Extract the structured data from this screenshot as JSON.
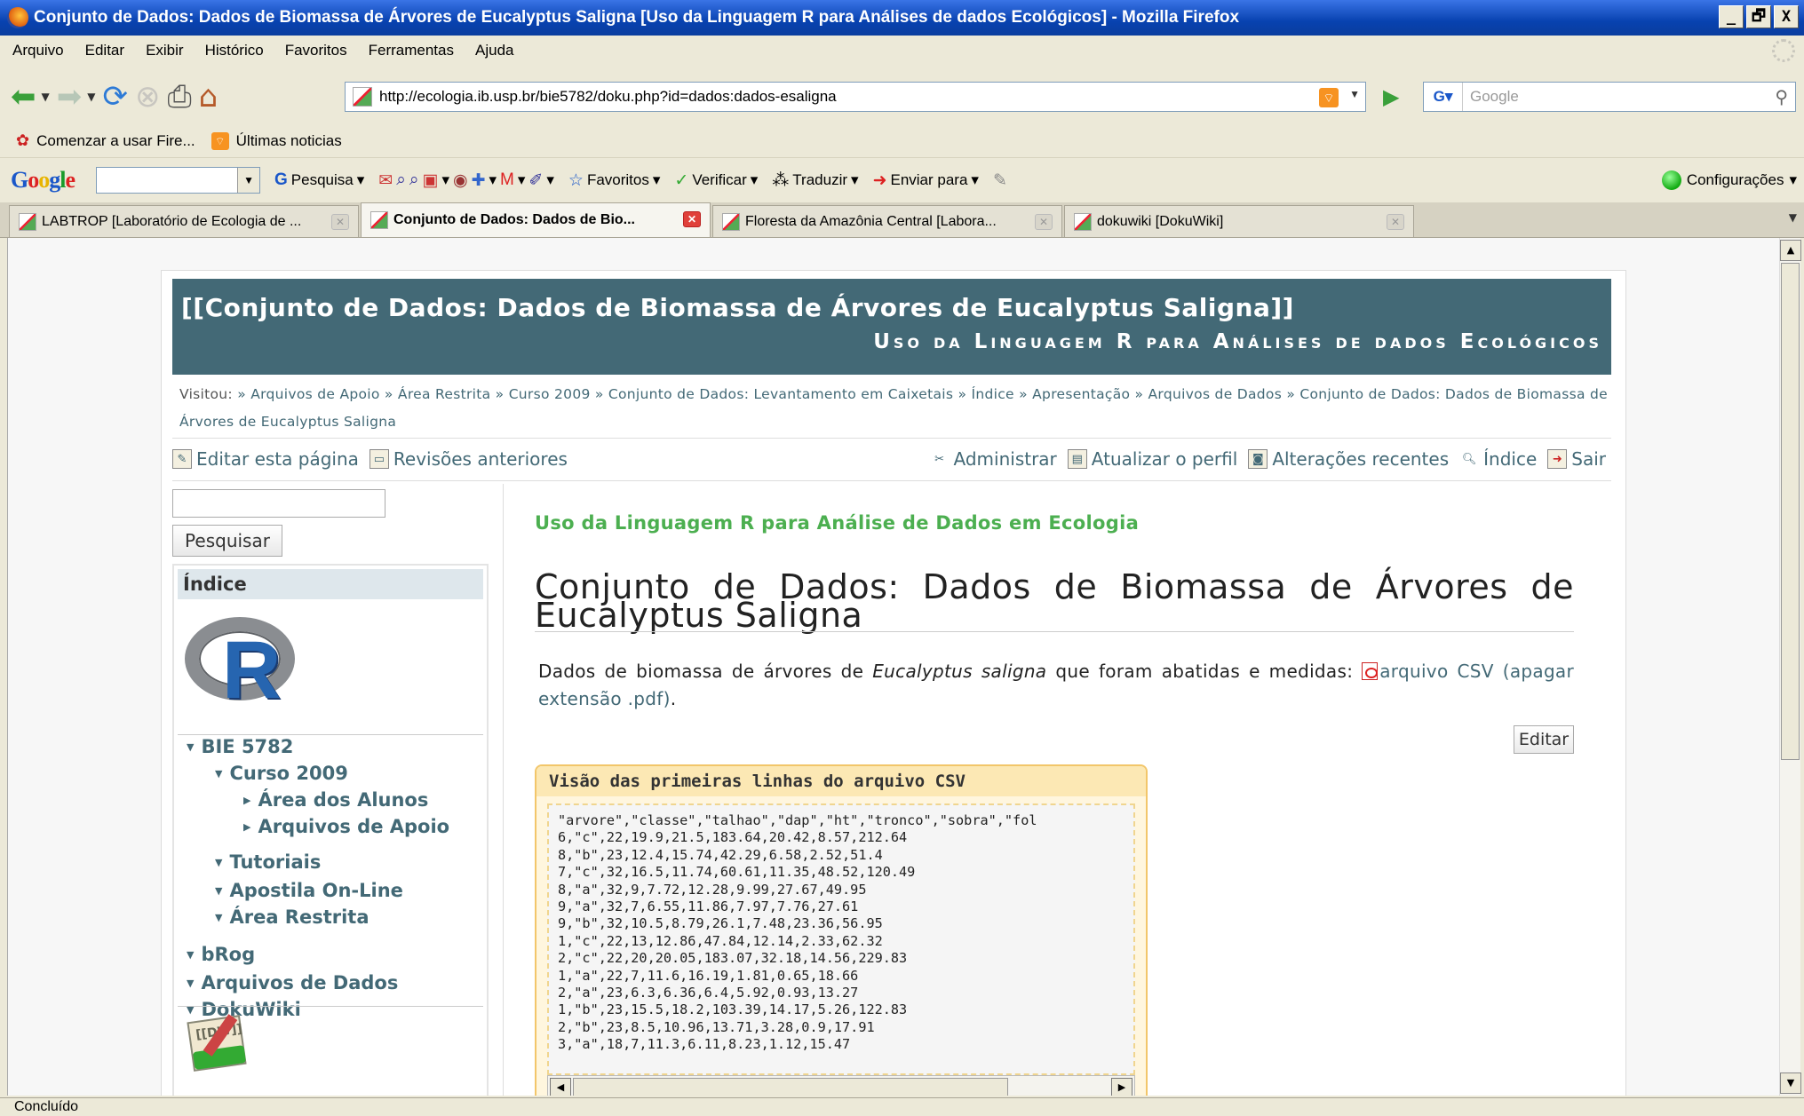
{
  "window": {
    "title": "Conjunto de Dados: Dados de Biomassa de Árvores de Eucalyptus Saligna [Uso da Linguagem R para Análises de dados Ecológicos] - Mozilla Firefox",
    "controls": [
      "_",
      "🗗",
      "X"
    ]
  },
  "menu": [
    "Arquivo",
    "Editar",
    "Exibir",
    "Histórico",
    "Favoritos",
    "Ferramentas",
    "Ajuda"
  ],
  "nav": {
    "url": "http://ecologia.ib.usp.br/bie5782/doku.php?id=dados:dados-esaligna",
    "search_placeholder": "Google"
  },
  "bookmarks": [
    "Comenzar a usar Fire...",
    "Últimas noticias"
  ],
  "google_toolbar": {
    "logo": "Google",
    "items": [
      "Pesquisa",
      "Favoritos",
      "Verificar",
      "Traduzir",
      "Enviar para"
    ],
    "settings": "Configurações"
  },
  "tabs": [
    {
      "label": "LABTROP [Laboratório de Ecologia de ..."
    },
    {
      "label": "Conjunto de Dados: Dados de Bio..."
    },
    {
      "label": "Floresta da Amazônia Central [Labora..."
    },
    {
      "label": "dokuwiki [DokuWiki]"
    }
  ],
  "status": "Concluído",
  "page": {
    "header_title": "[[Conjunto de Dados: Dados de Biomassa de Árvores de Eucalyptus Saligna]]",
    "header_subtitle": "Uso da Linguagem R para Análises de dados Ecológicos",
    "breadcrumb_label": "Visitou:",
    "breadcrumbs": [
      "Arquivos de Apoio",
      "Área Restrita",
      "Curso 2009",
      "Conjunto de Dados: Levantamento em Caixetais",
      "Índice",
      "Apresentação",
      "Arquivos de Dados",
      "Conjunto de Dados: Dados de Biomassa de Árvores de Eucalyptus Saligna"
    ],
    "actions_left": [
      "Editar esta página",
      "Revisões anteriores"
    ],
    "actions_right": [
      "Administrar",
      "Atualizar o perfil",
      "Alterações recentes",
      "Índice",
      "Sair"
    ],
    "search_button": "Pesquisar",
    "sidebar_title": "Índice",
    "toc": [
      {
        "label": "BIE 5782",
        "level": 0,
        "open": true
      },
      {
        "label": "Curso 2009",
        "level": 1,
        "open": true
      },
      {
        "label": "Área dos Alunos",
        "level": 2,
        "open": false
      },
      {
        "label": "Arquivos de Apoio",
        "level": 2,
        "open": false
      },
      {
        "label": "Tutoriais",
        "level": 1,
        "open": true
      },
      {
        "label": "Apostila On-Line",
        "level": 1,
        "open": true
      },
      {
        "label": "Área Restrita",
        "level": 1,
        "open": true
      },
      {
        "label": "bRog",
        "level": 0,
        "open": true
      },
      {
        "label": "Arquivos de Dados",
        "level": 0,
        "open": true
      },
      {
        "label": "DokuWiki",
        "level": 0,
        "open": true
      }
    ],
    "dokuwiki_logo_text": "[[DW]]",
    "kicker": "Uso da Linguagem R para Análise de Dados em Ecologia",
    "heading": "Conjunto de Dados: Dados de Biomassa de Árvores de Eucalyptus Saligna",
    "para_before": "Dados de biomassa de árvores de ",
    "para_italic": "Eucalyptus saligna",
    "para_after": " que foram abatidas e medidas: ",
    "para_link": "arquivo CSV (apagar extensão .pdf)",
    "para_end": ".",
    "edit_button": "Editar",
    "code_title": "Visão das primeiras linhas do arquivo CSV",
    "code_lines": [
      "\"arvore\",\"classe\",\"talhao\",\"dap\",\"ht\",\"tronco\",\"sobra\",\"fol",
      "6,\"c\",22,19.9,21.5,183.64,20.42,8.57,212.64",
      "8,\"b\",23,12.4,15.74,42.29,6.58,2.52,51.4",
      "7,\"c\",32,16.5,11.74,60.61,11.35,48.52,120.49",
      "8,\"a\",32,9,7.72,12.28,9.99,27.67,49.95",
      "9,\"a\",32,7,6.55,11.86,7.97,7.76,27.61",
      "9,\"b\",32,10.5,8.79,26.1,7.48,23.36,56.95",
      "1,\"c\",22,13,12.86,47.84,12.14,2.33,62.32",
      "2,\"c\",22,20,20.05,183.07,32.18,14.56,229.83",
      "1,\"a\",22,7,11.6,16.19,1.81,0.65,18.66",
      "2,\"a\",23,6.3,6.36,6.4,5.92,0.93,13.27",
      "1,\"b\",23,15.5,18.2,103.39,14.17,5.26,122.83",
      "2,\"b\",23,8.5,10.96,13.71,3.28,0.9,17.91",
      "3,\"a\",18,7,11.3,6.11,8.23,1.12,15.47"
    ]
  }
}
